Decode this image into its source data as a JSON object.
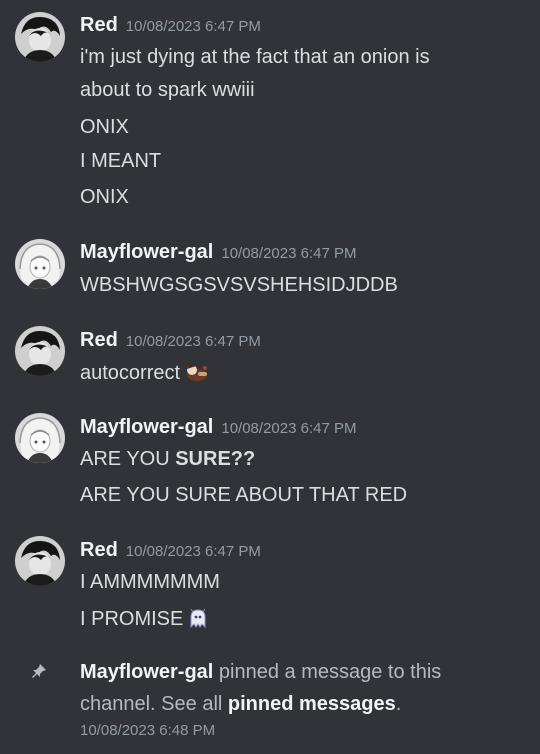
{
  "messages": [
    {
      "username": "Red",
      "timestamp": "10/08/2023 6:47 PM",
      "lines": [
        "i'm just dying at the fact that an onion is",
        "about to spark wwiii",
        "ONIX",
        "I MEANT",
        "ONIX"
      ]
    },
    {
      "username": "Mayflower-gal",
      "timestamp": "10/08/2023 6:47 PM",
      "lines": [
        "WBSHWGSGSVSVSHEHSIDJDDB"
      ]
    },
    {
      "username": "Red",
      "timestamp": "10/08/2023 6:47 PM",
      "lines": [
        "autocorrect"
      ],
      "emoji": "sticker-emoji"
    },
    {
      "username": "Mayflower-gal",
      "timestamp": "10/08/2023 6:47 PM",
      "line1_prefix": "ARE YOU ",
      "line1_bold": "SURE??",
      "lines": [
        "ARE YOU SURE ABOUT THAT RED"
      ]
    },
    {
      "username": "Red",
      "timestamp": "10/08/2023 6:47 PM",
      "lines": [
        "I AMMMMMMM",
        "I PROMISE"
      ],
      "emoji": "ghost-emoji"
    }
  ],
  "system": {
    "icon": "pin-icon",
    "actor": "Mayflower-gal",
    "text_a": " pinned a message to this",
    "text_b": "channel. See all ",
    "link": "pinned messages",
    "text_c": ".",
    "timestamp": "10/08/2023 6:48 PM"
  },
  "colors": {
    "background": "#313338",
    "username": "#f2f3f5",
    "message_text": "#dbdee1",
    "timestamp": "#949ba4"
  }
}
